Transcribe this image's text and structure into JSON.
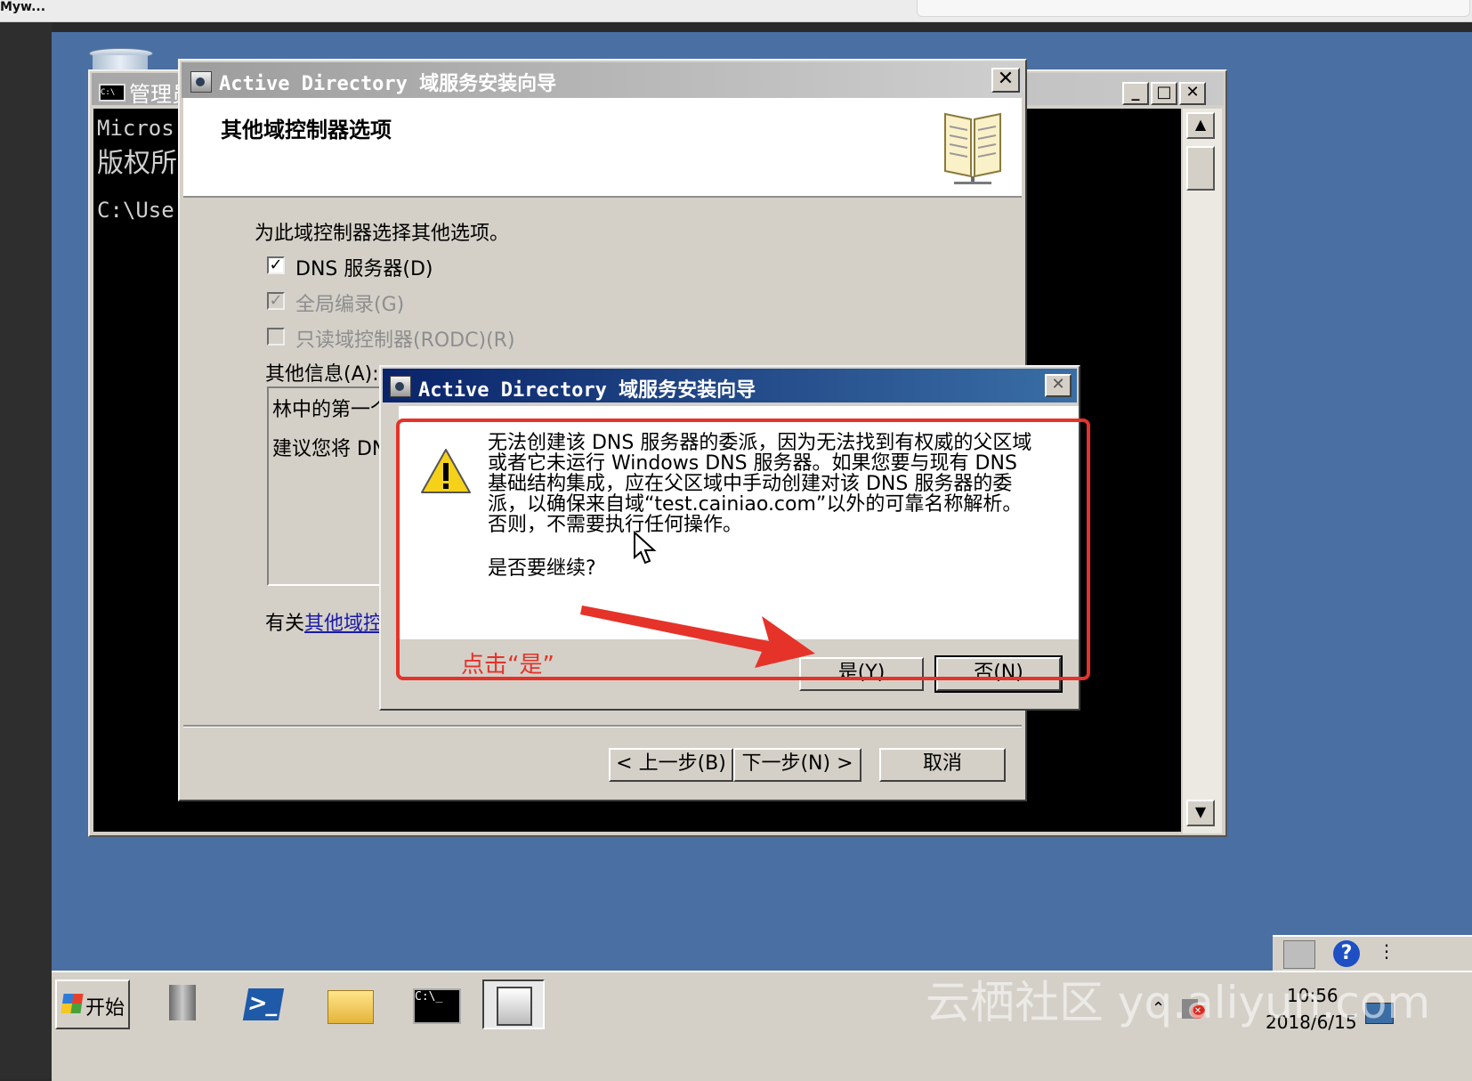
{
  "top_bar": {
    "text": "Myw..."
  },
  "console": {
    "title": "管理员",
    "lines": [
      "Micros",
      "版权所",
      "C:\\Use"
    ],
    "controls": {
      "minimize": "_",
      "maximize": "□",
      "close": "✕"
    },
    "scroll_up": "▲",
    "scroll_down": "▼",
    "icon_text": "C:\\"
  },
  "wizard": {
    "title": "Active Directory 域服务安装向导",
    "close": "✕",
    "header_title": "其他域控制器选项",
    "instruction": "为此域控制器选择其他选项。",
    "options": [
      {
        "label": "DNS 服务器(D)",
        "checked": true,
        "enabled": true
      },
      {
        "label": "全局编录(G)",
        "checked": true,
        "enabled": false
      },
      {
        "label": "只读域控制器(RODC)(R)",
        "checked": false,
        "enabled": false
      }
    ],
    "info_label": "其他信息(A):",
    "info_lines": [
      "林中的第一个",
      "建议您将 DN"
    ],
    "more_prefix": "有关",
    "more_link": "其他域控",
    "buttons": {
      "back": "< 上一步(B)",
      "next": "下一步(N) >",
      "cancel": "取消"
    }
  },
  "msgbox": {
    "title": "Active Directory 域服务安装向导",
    "close": "✕",
    "message": "无法创建该 DNS 服务器的委派，因为无法找到有权威的父区域或者它未运行 Windows DNS 服务器。如果您要与现有 DNS 基础结构集成，应在父区域中手动创建对该 DNS 服务器的委派，以确保来自域“test.cainiao.com”以外的可靠名称解析。否则，不需要执行任何操作。",
    "question": "是否要继续?",
    "buttons": {
      "yes": "是(Y)",
      "no": "否(N)"
    }
  },
  "annotation": {
    "label": "点击“是”",
    "color": "#e5332a"
  },
  "taskbar": {
    "start": "开始",
    "clock": "10:56",
    "date": "2018/6/15",
    "ps_glyph": ">_",
    "cmd_glyph": "C:\\_",
    "help_glyph": "?",
    "more_glyph": "⋮",
    "tray_up": "⌃"
  },
  "watermark": "云栖社区 yq.aliyun.com"
}
